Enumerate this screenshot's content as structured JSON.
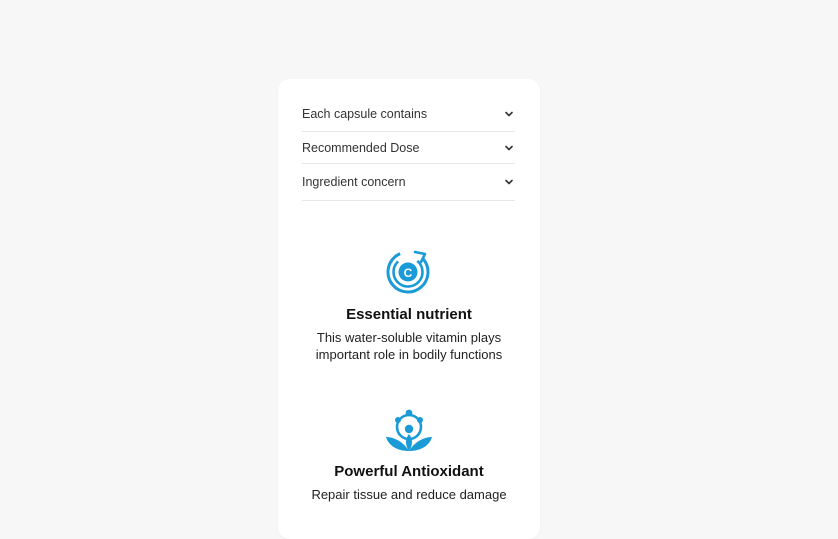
{
  "accordion": {
    "items": [
      {
        "label": "Each capsule contains",
        "icon": "chevron-down-icon"
      },
      {
        "label": "Recommended Dose",
        "icon": "chevron-down-icon"
      },
      {
        "label": "Ingredient concern",
        "icon": "chevron-down-icon"
      }
    ]
  },
  "features": [
    {
      "title": "Essential nutrient",
      "description": "This water-soluble vitamin plays important role in bodily functions",
      "icon": "vitamin-c-cycle-icon"
    },
    {
      "title": "Powerful Antioxidant",
      "description": "Repair tissue and reduce damage",
      "icon": "antioxidant-leaf-molecule-icon"
    }
  ],
  "colors": {
    "background": "#f7f7f7",
    "card": "#ffffff",
    "accent": "#1a9bd7"
  }
}
